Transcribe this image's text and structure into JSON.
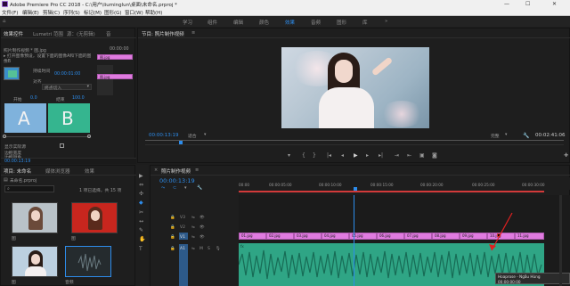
{
  "app": {
    "title": "Adobe Premiere Pro CC 2018 - C:\\用户\\liuminglun\\桌面\\未命名.prproj *",
    "window_controls": [
      "—",
      "☐",
      "✕"
    ]
  },
  "menu": [
    "文件(F)",
    "编辑(E)",
    "剪辑(C)",
    "序列(S)",
    "标记(M)",
    "图形(G)",
    "窗口(W)",
    "帮助(H)"
  ],
  "workspaces": {
    "items": [
      "学习",
      "组件",
      "编辑",
      "颜色",
      "效果",
      "音频",
      "图形",
      "库"
    ],
    "active_index": 4
  },
  "effect_controls": {
    "tabs": [
      "效果控件",
      "Lumetri 范围",
      "源：(无剪辑)",
      "音"
    ],
    "master": "照片制作视频 * 图.jpg",
    "timecode_top": "00:00:00",
    "clip_labels": [
      "图.jpg",
      "图.jpg"
    ],
    "lines": [
      "▸ 打开图像预设，设置下面的图像A和下面的图像B",
      "持续时间",
      "00:00:01:00",
      "对齐",
      "终点切入"
    ],
    "ab_labels": [
      "A",
      "B"
    ],
    "start_label": "开始",
    "start_value": "0.0",
    "end_label": "结束",
    "end_value": "100.0",
    "checkbox_labels": [
      "显示实际源",
      "边框宽度",
      "边框颜色"
    ],
    "bottom_timecode": "00:00:13:19"
  },
  "program_monitor": {
    "tab": "节目: 照片制作视频",
    "timecode": "00:00:13:19",
    "fit": "适合",
    "quality": "完整",
    "duration": "00:02:41:06",
    "transport": [
      "▾",
      "{",
      "}",
      "|◂",
      "◂",
      "▶",
      "▸",
      "▸|",
      "⇥",
      "⇤",
      "▣",
      "◙",
      "✚"
    ]
  },
  "project_panel": {
    "tabs": [
      "项目: 未命名",
      "媒体浏览器",
      "效果"
    ],
    "file": "未命名.prproj",
    "search_placeholder": "",
    "count": "1 项已选择，共 15 项",
    "thumbs": [
      "图",
      "图",
      "图",
      "音频"
    ]
  },
  "timeline": {
    "tab": "照片制作视频",
    "timecode": "00:00:13:19",
    "ruler": [
      "00:00",
      "00:00:05:00",
      "00:00:10:00",
      "00:00:15:00",
      "00:00:20:00",
      "00:00:25:00",
      "00:00:30:00"
    ],
    "video_tracks": [
      "V3",
      "V2",
      "V1"
    ],
    "audio_tracks": [
      "A1",
      "A2"
    ],
    "clips": [
      "01.jpg",
      "02.jpg",
      "03.jpg",
      "04.jpg",
      "05.jpg",
      "06.jpg",
      "07.jpg",
      "08.jpg",
      "09.jpg",
      "10.jpg",
      "11.jpg"
    ],
    "audio_clip": "Hoaprose - Ngẫu Hùng",
    "audio_clip_tc": "00:00:00:00",
    "audio_labels": [
      "fx",
      "fx"
    ]
  },
  "tools": [
    "▶",
    "⇔",
    "✣",
    "◆",
    "✂",
    "↔",
    "✎",
    "✋",
    "T"
  ],
  "colors": {
    "accent": "#2d8ceb",
    "clip": "#e07be0",
    "audio": "#2fa585",
    "playhead": "#2d8ceb"
  }
}
